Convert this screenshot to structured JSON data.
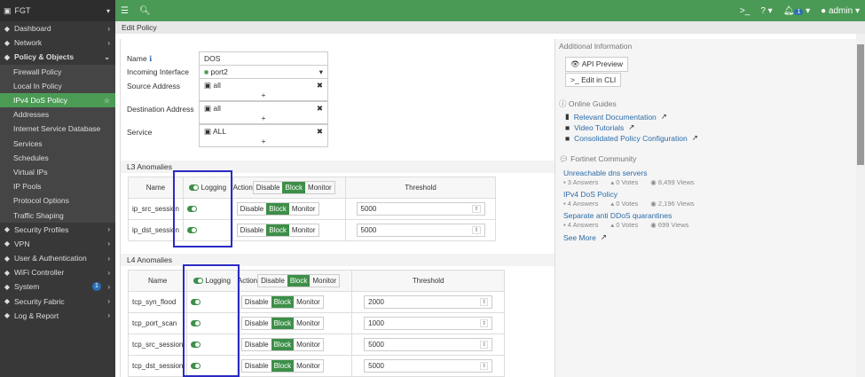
{
  "sidebar": {
    "device": "FGT",
    "items": [
      {
        "label": "Dashboard",
        "icon": "dashboard-icon",
        "type": "top",
        "chev": ">"
      },
      {
        "label": "Network",
        "icon": "network-icon",
        "type": "top",
        "chev": ">"
      },
      {
        "label": "Policy & Objects",
        "icon": "policy-icon",
        "type": "top bold",
        "chev": "v"
      },
      {
        "label": "Firewall Policy",
        "type": "sub"
      },
      {
        "label": "Local In Policy",
        "type": "sub"
      },
      {
        "label": "IPv4 DoS Policy",
        "type": "sub active",
        "star": true
      },
      {
        "label": "Addresses",
        "type": "sub"
      },
      {
        "label": "Internet Service Database",
        "type": "sub"
      },
      {
        "label": "Services",
        "type": "sub"
      },
      {
        "label": "Schedules",
        "type": "sub"
      },
      {
        "label": "Virtual IPs",
        "type": "sub"
      },
      {
        "label": "IP Pools",
        "type": "sub"
      },
      {
        "label": "Protocol Options",
        "type": "sub"
      },
      {
        "label": "Traffic Shaping",
        "type": "sub"
      },
      {
        "label": "Security Profiles",
        "icon": "shield-icon",
        "type": "top",
        "chev": ">"
      },
      {
        "label": "VPN",
        "icon": "vpn-icon",
        "type": "top",
        "chev": ">"
      },
      {
        "label": "User & Authentication",
        "icon": "user-icon",
        "type": "top",
        "chev": ">"
      },
      {
        "label": "WiFi Controller",
        "icon": "wifi-icon",
        "type": "top",
        "chev": ">"
      },
      {
        "label": "System",
        "icon": "gear-icon",
        "type": "top",
        "chev": ">",
        "badge": "1"
      },
      {
        "label": "Security Fabric",
        "icon": "fabric-icon",
        "type": "top",
        "chev": ">"
      },
      {
        "label": "Log & Report",
        "icon": "chart-icon",
        "type": "top",
        "chev": ">"
      }
    ]
  },
  "topbar": {
    "notifications": "1",
    "user": "admin"
  },
  "breadcrumb": "Edit Policy",
  "form": {
    "name_label": "Name",
    "name_value": "DOS",
    "iface_label": "Incoming Interface",
    "iface_value": "port2",
    "src_label": "Source Address",
    "src_value": "all",
    "dst_label": "Destination Address",
    "dst_value": "all",
    "svc_label": "Service",
    "svc_value": "ALL",
    "add": "+"
  },
  "headers": {
    "name": "Name",
    "logging": "Logging",
    "action": "Action",
    "threshold": "Threshold",
    "disable": "Disable",
    "block": "Block",
    "monitor": "Monitor"
  },
  "l3": {
    "title": "L3 Anomalies",
    "rows": [
      {
        "name": "ip_src_session",
        "threshold": "5000"
      },
      {
        "name": "ip_dst_session",
        "threshold": "5000"
      }
    ]
  },
  "l4": {
    "title": "L4 Anomalies",
    "rows": [
      {
        "name": "tcp_syn_flood",
        "threshold": "2000"
      },
      {
        "name": "tcp_port_scan",
        "threshold": "1000"
      },
      {
        "name": "tcp_src_session",
        "threshold": "5000"
      },
      {
        "name": "tcp_dst_session",
        "threshold": "5000"
      }
    ]
  },
  "side": {
    "title": "Additional Information",
    "api_preview": "API Preview",
    "edit_cli": "Edit in CLI",
    "guides_title": "Online Guides",
    "guides": [
      "Relevant Documentation",
      "Video Tutorials",
      "Consolidated Policy Configuration"
    ],
    "community_title": "Fortinet Community",
    "posts": [
      {
        "title": "Unreachable dns servers",
        "answers": "3 Answers",
        "votes": "0 Votes",
        "views": "8,499 Views"
      },
      {
        "title": "IPv4 DoS Policy",
        "answers": "4 Answers",
        "votes": "0 Votes",
        "views": "2,196 Views"
      },
      {
        "title": "Separate anti DDoS quarantines",
        "answers": "4 Answers",
        "votes": "0 Votes",
        "views": "699 Views"
      }
    ],
    "see_more": "See More"
  },
  "colors": {
    "accent": "#4a9a55",
    "highlight": "#2b2bc4",
    "link": "#2c6ca8"
  }
}
